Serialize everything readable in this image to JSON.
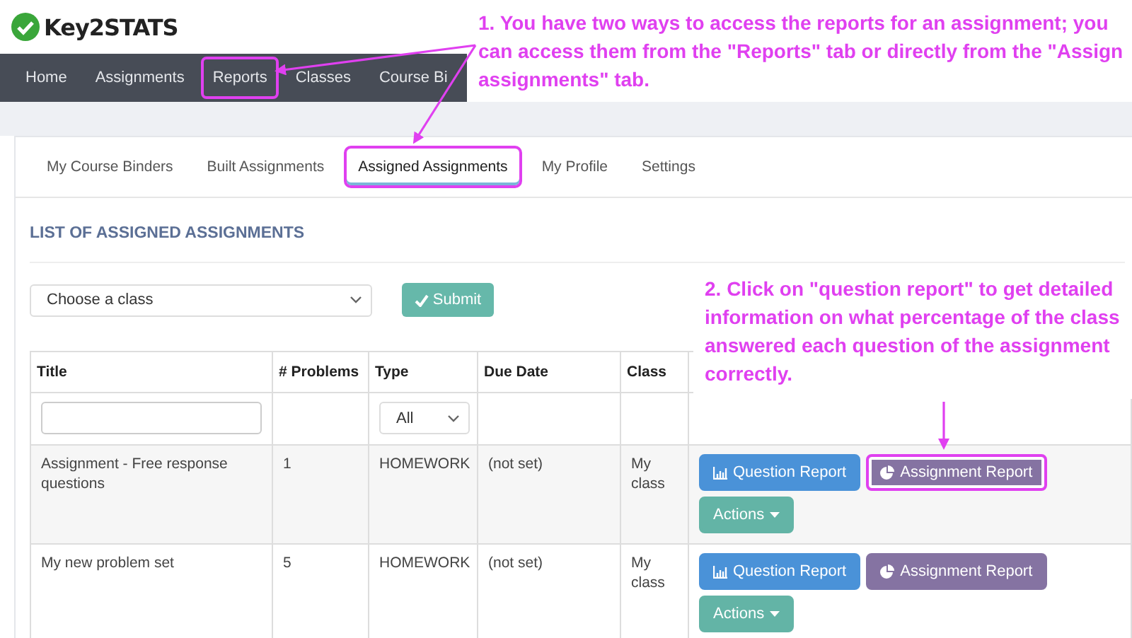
{
  "logo": {
    "text": "Key2STATS"
  },
  "nav": [
    {
      "label": "Home",
      "highlighted": false
    },
    {
      "label": "Assignments",
      "highlighted": false
    },
    {
      "label": "Reports",
      "highlighted": true
    },
    {
      "label": "Classes",
      "highlighted": false
    },
    {
      "label": "Course Bi",
      "highlighted": false
    }
  ],
  "tabs": [
    {
      "label": "My Course Binders",
      "selected": false,
      "highlighted": false
    },
    {
      "label": "Built Assignments",
      "selected": false,
      "highlighted": false
    },
    {
      "label": "Assigned Assignments",
      "selected": true,
      "highlighted": true
    },
    {
      "label": "My Profile",
      "selected": false,
      "highlighted": false
    },
    {
      "label": "Settings",
      "selected": false,
      "highlighted": false
    }
  ],
  "section_title": "LIST OF ASSIGNED ASSIGNMENTS",
  "class_select": {
    "value": "Choose a class"
  },
  "submit_button": {
    "label": "Submit"
  },
  "table": {
    "columns": [
      "Title",
      "# Problems",
      "Type",
      "Due Date",
      "Class"
    ],
    "type_filter": "All",
    "rows": [
      {
        "title": "Assignment - Free response questions",
        "problems": "1",
        "type": "HOMEWORK",
        "due_date": "(not set)",
        "class": "My class",
        "question_report": "Question Report",
        "assignment_report": "Assignment Report",
        "report_highlighted": true,
        "actions": "Actions"
      },
      {
        "title": "My new problem set",
        "problems": "5",
        "type": "HOMEWORK",
        "due_date": "(not set)",
        "class": "My class",
        "question_report": "Question Report",
        "assignment_report": "Assignment Report",
        "report_highlighted": false,
        "actions": "Actions"
      }
    ]
  },
  "annotations": [
    {
      "text": "1. You have two ways to access the reports for an assignment; you can access them from the \"Reports\" tab or directly from the \"Assign assignments\" tab."
    },
    {
      "text": "2. Click on \"question report\" to get detailed information on what percentage of the class answered each question of the assignment correctly."
    }
  ]
}
